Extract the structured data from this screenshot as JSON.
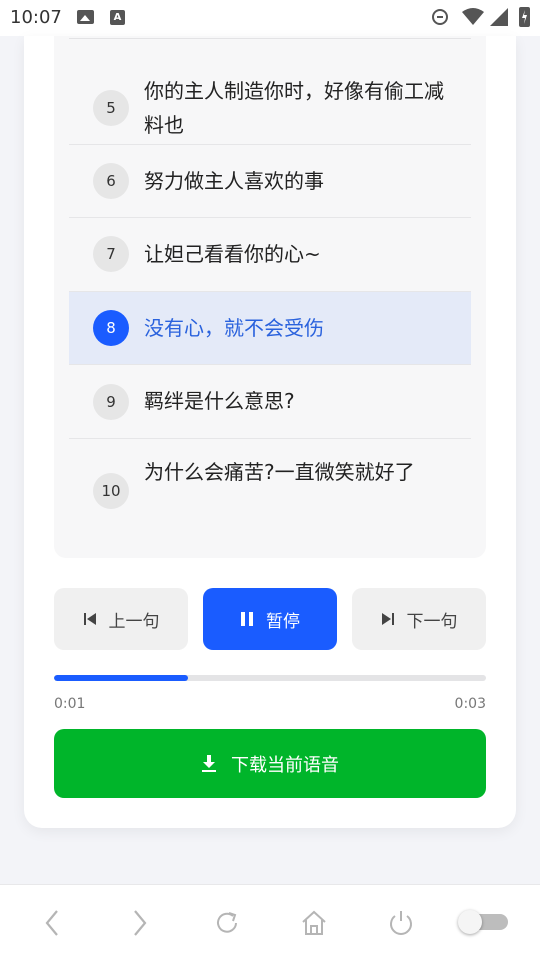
{
  "status_bar": {
    "time": "10:07",
    "a_label": "A"
  },
  "sentences": [
    {
      "num": "5",
      "text": "你的主人制造你时，好像有偷工减料也",
      "active": false
    },
    {
      "num": "6",
      "text": "努力做主人喜欢的事",
      "active": false
    },
    {
      "num": "7",
      "text": "让妲己看看你的心~",
      "active": false
    },
    {
      "num": "8",
      "text": "没有心，就不会受伤",
      "active": true
    },
    {
      "num": "9",
      "text": "羁绊是什么意思?",
      "active": false
    },
    {
      "num": "10",
      "text": "为什么会痛苦?一直微笑就好了",
      "active": false
    }
  ],
  "controls": {
    "prev_label": "上一句",
    "pause_label": "暂停",
    "next_label": "下一句"
  },
  "progress": {
    "current": "0:01",
    "total": "0:03",
    "fraction": 0.31
  },
  "download_label": "下载当前语音",
  "colors": {
    "accent": "#1a5cff",
    "download": "#00b52a"
  },
  "nav_icons": [
    "back-icon",
    "forward-icon",
    "refresh-icon",
    "home-icon",
    "power-icon",
    "toggle-switch"
  ]
}
